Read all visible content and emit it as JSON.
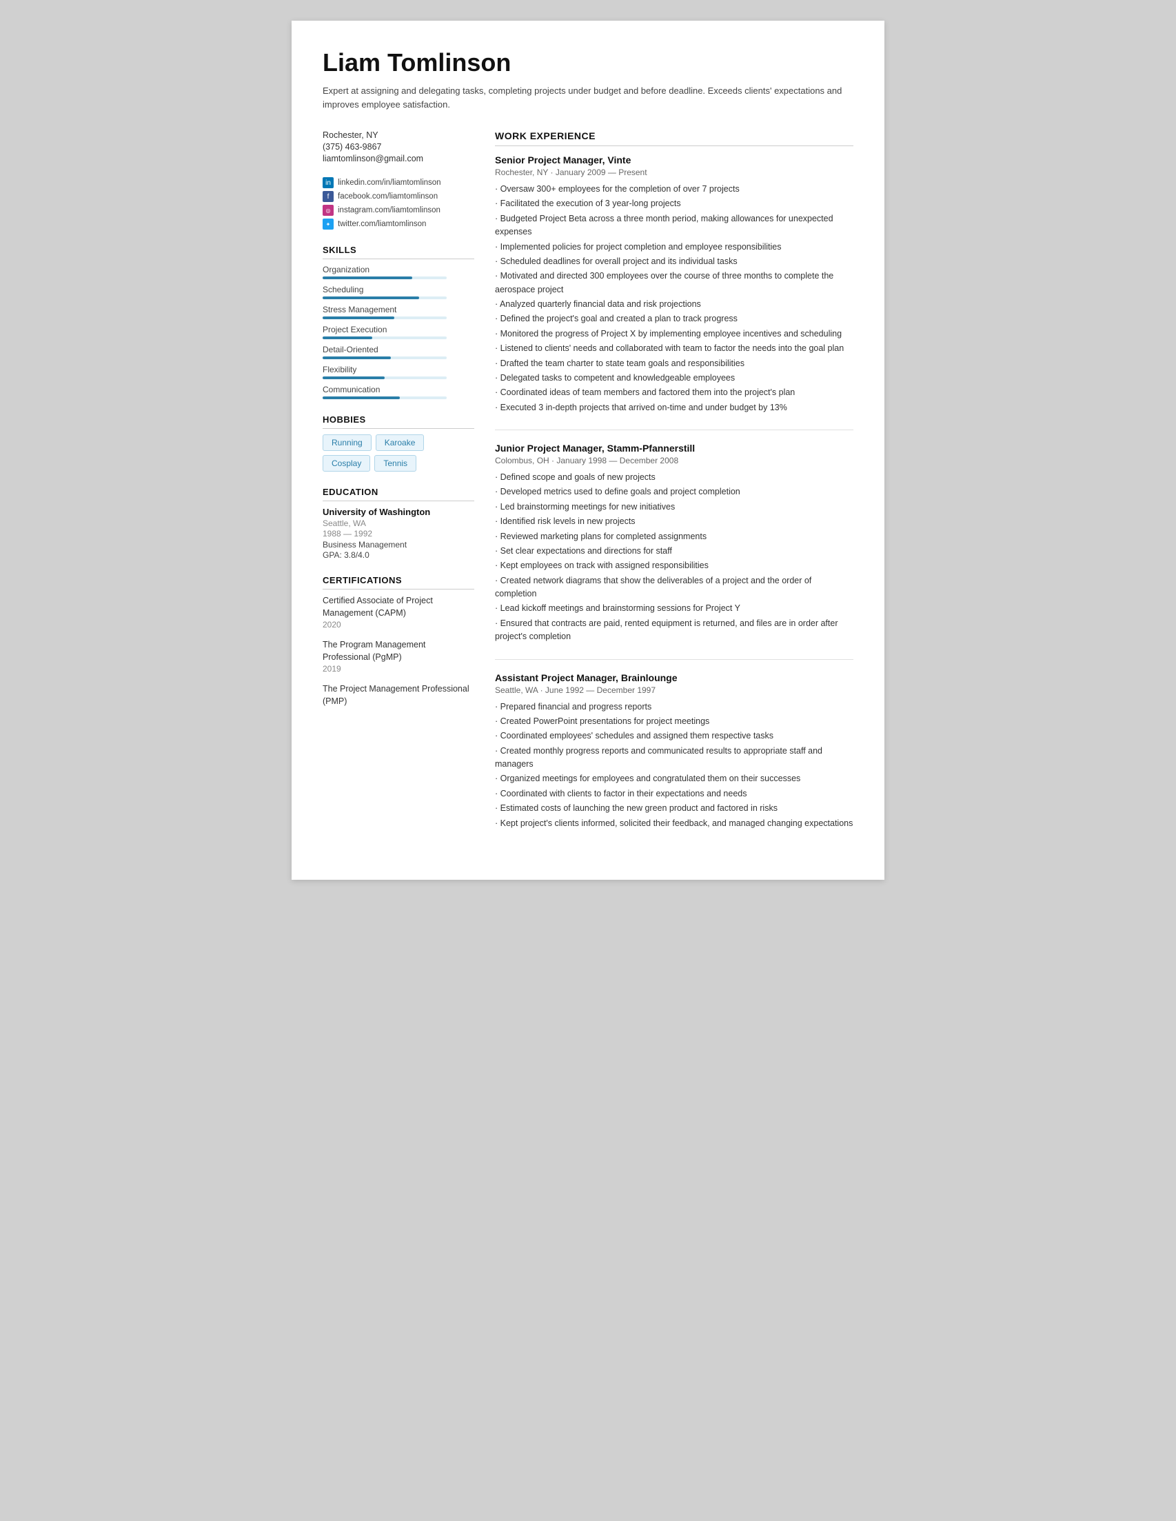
{
  "header": {
    "name": "Liam Tomlinson",
    "summary": "Expert at assigning and delegating tasks, completing projects under budget and before deadline. Exceeds clients' expectations and improves employee satisfaction."
  },
  "contact": {
    "location": "Rochester, NY",
    "phone": "(375) 463-9867",
    "email": "liamtomlinson@gmail.com"
  },
  "social": [
    {
      "icon": "in",
      "iconClass": "icon-linkedin",
      "text": "linkedin.com/in/liamtomlinson"
    },
    {
      "icon": "f",
      "iconClass": "icon-facebook",
      "text": "facebook.com/liamtomlinson"
    },
    {
      "icon": "◎",
      "iconClass": "icon-instagram",
      "text": "instagram.com/liamtomlinson"
    },
    {
      "icon": "✦",
      "iconClass": "icon-twitter",
      "text": "twitter.com/liamtomlinson"
    }
  ],
  "skills_title": "SKILLS",
  "skills": [
    {
      "name": "Organization",
      "percent": 72
    },
    {
      "name": "Scheduling",
      "percent": 78
    },
    {
      "name": "Stress Management",
      "percent": 58
    },
    {
      "name": "Project Execution",
      "percent": 40
    },
    {
      "name": "Detail-Oriented",
      "percent": 55
    },
    {
      "name": "Flexibility",
      "percent": 50
    },
    {
      "name": "Communication",
      "percent": 62
    }
  ],
  "hobbies_title": "HOBBIES",
  "hobbies": [
    "Running",
    "Karoake",
    "Cosplay",
    "Tennis"
  ],
  "education_title": "EDUCATION",
  "education": [
    {
      "school": "University of Washington",
      "location": "Seattle, WA",
      "years": "1988 — 1992",
      "field": "Business Management",
      "gpa": "GPA: 3.8/4.0"
    }
  ],
  "certifications_title": "CERTIFICATIONS",
  "certifications": [
    {
      "name": "Certified Associate of Project Management (CAPM)",
      "year": "2020"
    },
    {
      "name": "The Program Management Professional (PgMP)",
      "year": "2019"
    },
    {
      "name": "The Project Management Professional (PMP)",
      "year": ""
    }
  ],
  "work_title": "WORK EXPERIENCE",
  "jobs": [
    {
      "title": "Senior Project Manager, Vinte",
      "meta": "Rochester, NY · January 2009 — Present",
      "bullets": [
        "· Oversaw 300+ employees for the completion of over 7 projects",
        "· Facilitated the execution of 3 year-long projects",
        "· Budgeted Project Beta across a three month period, making allowances for unexpected expenses",
        "· Implemented policies for project completion and employee responsibilities",
        "· Scheduled deadlines for overall project and its individual tasks",
        "· Motivated and directed 300 employees over the course of three months to complete the aerospace project",
        "· Analyzed quarterly financial data and risk projections",
        "· Defined the project's goal and created a plan to track progress",
        "· Monitored the progress of Project X by implementing employee incentives and scheduling",
        "· Listened to clients' needs and collaborated with team to factor the needs into the goal plan",
        "· Drafted the team charter to state team goals and responsibilities",
        "· Delegated tasks to competent and knowledgeable employees",
        "· Coordinated ideas of team members and factored them into the project's plan",
        "· Executed 3 in-depth projects that arrived on-time and under budget by 13%"
      ]
    },
    {
      "title": "Junior Project Manager, Stamm-Pfannerstill",
      "meta": "Colombus, OH · January 1998 — December 2008",
      "bullets": [
        "· Defined scope and goals of new projects",
        "· Developed metrics used to define goals and project completion",
        "· Led brainstorming meetings for new initiatives",
        "· Identified risk levels in new projects",
        "· Reviewed marketing plans for completed assignments",
        "· Set clear expectations and directions for staff",
        "· Kept employees on track with assigned responsibilities",
        "· Created network diagrams that show the deliverables of a project and the order of completion",
        "· Lead kickoff meetings and brainstorming sessions for Project Y",
        "· Ensured that contracts are paid, rented equipment is returned, and files are in order after project's completion"
      ]
    },
    {
      "title": "Assistant Project Manager, Brainlounge",
      "meta": "Seattle, WA · June 1992 — December 1997",
      "bullets": [
        "· Prepared financial and progress reports",
        "· Created PowerPoint presentations for project meetings",
        "· Coordinated employees' schedules and assigned them respective tasks",
        "· Created monthly progress reports and communicated results to appropriate staff and managers",
        "· Organized meetings for employees and congratulated them on their successes",
        "· Coordinated with clients to factor in their expectations and needs",
        "· Estimated costs of launching the new green product and factored in risks",
        "· Kept project's clients informed, solicited their feedback, and managed changing expectations"
      ]
    }
  ]
}
